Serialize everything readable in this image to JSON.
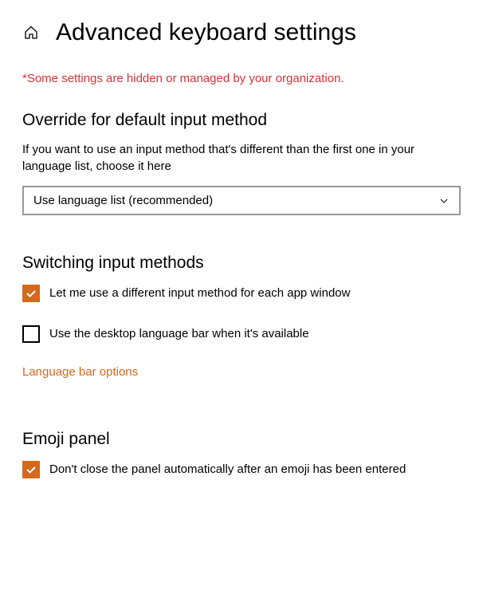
{
  "header": {
    "title": "Advanced keyboard settings"
  },
  "policyNotice": "*Some settings are hidden or managed by your organization.",
  "override": {
    "title": "Override for default input method",
    "description": "If you want to use an input method that's different than the first one in your language list, choose it here",
    "selected": "Use language list (recommended)"
  },
  "switching": {
    "title": "Switching input methods",
    "checkbox1": {
      "label": "Let me use a different input method for each app window",
      "checked": true
    },
    "checkbox2": {
      "label": "Use the desktop language bar when it's available",
      "checked": false
    },
    "link": "Language bar options"
  },
  "emoji": {
    "title": "Emoji panel",
    "checkbox": {
      "label": "Don't close the panel automatically after an emoji has been entered",
      "checked": true
    }
  }
}
